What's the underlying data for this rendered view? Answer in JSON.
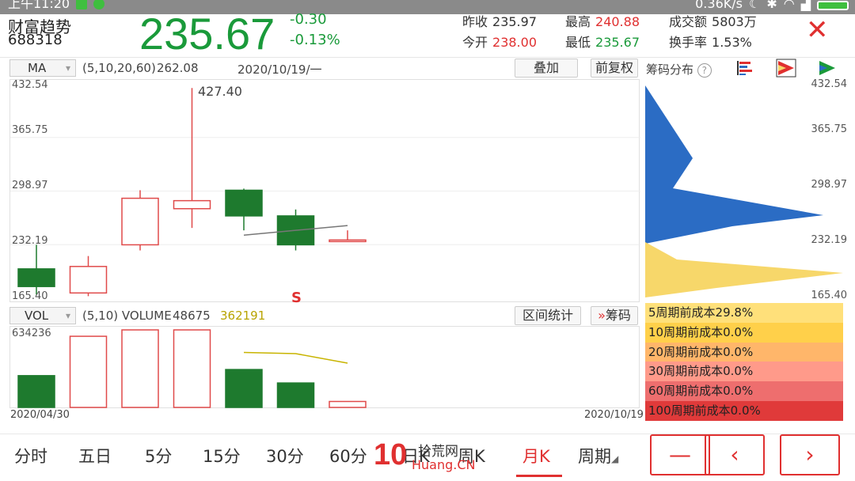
{
  "status_bar": {
    "time": "上午11:20",
    "net_speed": "0.36K/s"
  },
  "header": {
    "stock_name": "财富趋势",
    "stock_code": "688318",
    "price": "235.67",
    "change": "-0.30",
    "change_pct": "-0.13%",
    "quote": {
      "prev_close_label": "昨收",
      "prev_close": "235.97",
      "open_label": "今开",
      "open": "238.00",
      "high_label": "最高",
      "high": "240.88",
      "low_label": "最低",
      "low": "235.67",
      "amount_label": "成交额",
      "amount": "5803万",
      "turnover_label": "换手率",
      "turnover": "1.53%"
    },
    "close_icon": "close-icon"
  },
  "toolbar": {
    "indicator": "MA",
    "params": "(5,10,20,60)",
    "ma_value": "262.08",
    "date": "2020/10/19/一",
    "overlay_button": "叠加",
    "adjust_button": "前复权",
    "chip_label": "筹码分布"
  },
  "chart_data": {
    "type": "candlestick",
    "y_ticks": [
      "432.54",
      "365.75",
      "298.97",
      "232.19",
      "165.40"
    ],
    "ylim": [
      165.4,
      432.54
    ],
    "max_label": "427.40",
    "signal_label": "S",
    "candles": [
      {
        "open": 180,
        "close": 202,
        "high": 232,
        "low": 170,
        "color": "green"
      },
      {
        "open": 172,
        "close": 205,
        "high": 218,
        "low": 168,
        "color": "red"
      },
      {
        "open": 232,
        "close": 290,
        "high": 300,
        "low": 225,
        "color": "red"
      },
      {
        "open": 277,
        "close": 287,
        "high": 427.4,
        "low": 253,
        "color": "red"
      },
      {
        "open": 300,
        "close": 268,
        "high": 302,
        "low": 250,
        "color": "green"
      },
      {
        "open": 268,
        "close": 232,
        "high": 276,
        "low": 225,
        "color": "green"
      },
      {
        "open": 238,
        "close": 236,
        "high": 250,
        "low": 236,
        "color": "red"
      }
    ],
    "ma_line": [
      [
        4,
        244
      ],
      [
        5,
        250
      ],
      [
        6,
        256
      ]
    ],
    "dates": [
      "2020/04/30",
      "2020/10/19"
    ]
  },
  "volume": {
    "indicator": "VOL",
    "params": "(5,10) VOLUME",
    "value": "48675",
    "ma_value": "362191",
    "y_max_label": "634236",
    "ylim": [
      0,
      634236
    ],
    "bars": [
      {
        "value": 260000,
        "color": "green"
      },
      {
        "value": 582000,
        "color": "red"
      },
      {
        "value": 634236,
        "color": "red"
      },
      {
        "value": 634236,
        "color": "red"
      },
      {
        "value": 310000,
        "color": "green"
      },
      {
        "value": 200000,
        "color": "green"
      },
      {
        "value": 48675,
        "color": "red"
      }
    ],
    "ma_line": [
      [
        4,
        450000
      ],
      [
        5,
        440000
      ],
      [
        6,
        362191
      ]
    ],
    "interval_button": "区间统计",
    "chip_button": "筹码"
  },
  "chip_panel": {
    "ticks": [
      "432.54",
      "365.75",
      "298.97",
      "232.19",
      "165.40"
    ],
    "blue_color": "#2b6cc4",
    "yellow_color": "#f7d76a",
    "costs": [
      {
        "label": "5周期前成本29.8%",
        "color": "#ffe07a"
      },
      {
        "label": "10周期前成本0.0%",
        "color": "#ffd04a"
      },
      {
        "label": "20周期前成本0.0%",
        "color": "#ffb66a"
      },
      {
        "label": "30周期前成本0.0%",
        "color": "#ff9a8a"
      },
      {
        "label": "60周期前成本0.0%",
        "color": "#ee6e6e"
      },
      {
        "label": "100周期前成本0.0%",
        "color": "#e03a3a"
      }
    ]
  },
  "bottom_tabs": [
    {
      "label": "分时"
    },
    {
      "label": "五日"
    },
    {
      "label": "5分"
    },
    {
      "label": "15分"
    },
    {
      "label": "30分"
    },
    {
      "label": "60分"
    },
    {
      "label": "日K"
    },
    {
      "label": "周K"
    },
    {
      "label": "月K",
      "active": true
    },
    {
      "label": "周期"
    }
  ],
  "nav_buttons": {
    "minus": "—",
    "prev": "‹",
    "next": "›"
  },
  "watermark": {
    "number": "10",
    "cn": "拾荒网",
    "domain": "Huang.CN"
  }
}
